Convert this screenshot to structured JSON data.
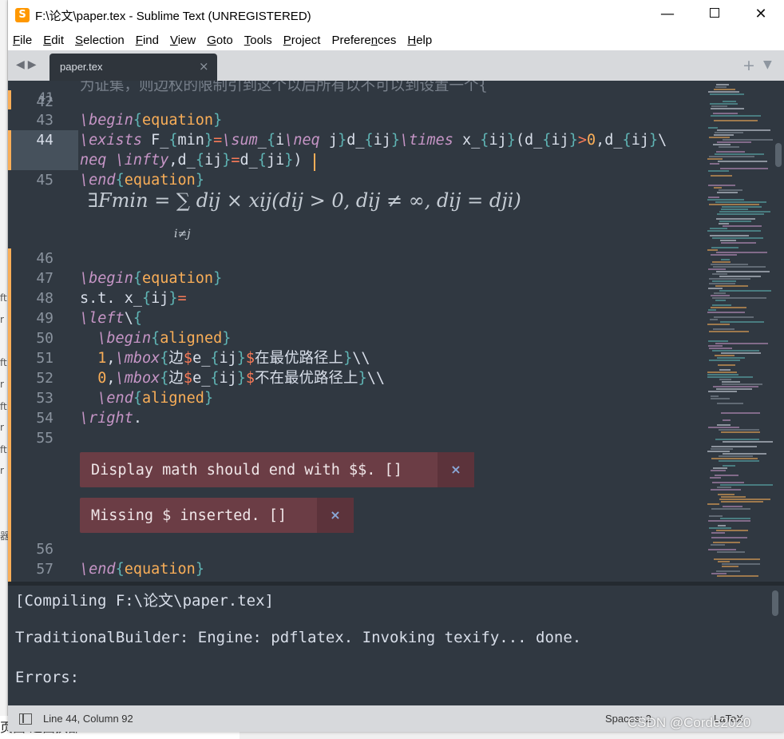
{
  "window": {
    "title": "F:\\论文\\paper.tex - Sublime Text (UNREGISTERED)",
    "minimize": "—",
    "close": "✕"
  },
  "menu": [
    {
      "acc": "F",
      "rest": "ile"
    },
    {
      "acc": "E",
      "rest": "dit"
    },
    {
      "acc": "S",
      "rest": "election"
    },
    {
      "acc": "F",
      "rest": "ind"
    },
    {
      "acc": "V",
      "rest": "iew"
    },
    {
      "acc": "G",
      "rest": "oto"
    },
    {
      "acc": "T",
      "rest": "ools"
    },
    {
      "acc": "P",
      "rest": "roject"
    },
    {
      "pre": "Prefere",
      "acc": "n",
      "rest": "ces"
    },
    {
      "acc": "H",
      "rest": "elp"
    }
  ],
  "tabs": {
    "active": "paper.tex",
    "close": "×",
    "plus": "+",
    "menu": "▼",
    "nav": "◀▶"
  },
  "editor": {
    "phantom_top": "为证集，则边权的限制引到这个以后所有以不可以到设置一个{",
    "line_numbers": [
      "41",
      "42",
      "43",
      "44",
      "45",
      "46",
      "47",
      "48",
      "49",
      "50",
      "51",
      "52",
      "53",
      "54",
      "55",
      "56",
      "57"
    ],
    "current_line": "44",
    "math_preview": "∃F",
    "math_preview_sub": "min",
    "math_preview_rest": " = ∑ d",
    "math_full": "∃Fmin = ∑ dij × xij(dij > 0, dij ≠ ∞, dij = dji)",
    "math_under": "i≠j",
    "errors": [
      {
        "text": "Display math should end with $$. []",
        "close": "×"
      },
      {
        "text": "Missing $ inserted. []",
        "close": "×"
      }
    ]
  },
  "panel": {
    "lines": [
      "[Compiling F:\\论文\\paper.tex]",
      "",
      "TraditionalBuilder: Engine: pdflatex. Invoking texify... done.",
      "",
      "Errors:"
    ]
  },
  "status": {
    "position": "Line 44, Column 92",
    "spaces": "Spaces: 2",
    "syntax": "LaTeX"
  },
  "watermark": "CSDN @Corde2020",
  "background": {
    "bottom_text": "页面  通面换部",
    "fragments": [
      "ft",
      "r",
      "ft",
      "r",
      "ft",
      "r",
      "ft",
      "r",
      "器"
    ]
  },
  "colors": {
    "editor_bg": "#303841",
    "keyword": "#c695c6",
    "name": "#f9ae58",
    "brace": "#5fb4b4",
    "operator": "#f97b58",
    "error_bg": "#6b3d45"
  }
}
